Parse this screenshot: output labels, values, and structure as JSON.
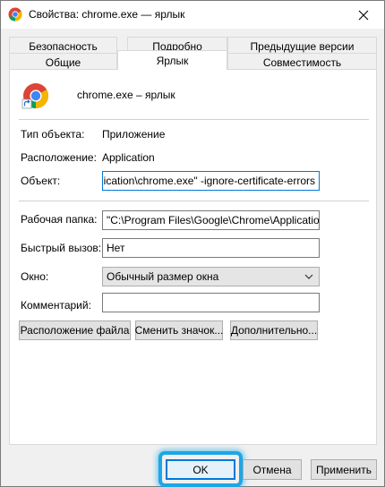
{
  "window": {
    "title": "Свойства: chrome.exe — ярлык"
  },
  "tabs_row1": [
    {
      "label": "Безопасность"
    },
    {
      "label": "Подробно"
    },
    {
      "label": "Предыдущие версии"
    }
  ],
  "tabs_row2": [
    {
      "label": "Общие"
    },
    {
      "label": "Ярлык"
    },
    {
      "label": "Совместимость"
    }
  ],
  "active_tab": "Ярлык",
  "header": {
    "file_name": "chrome.exe – ярлык"
  },
  "info": {
    "type_label": "Тип объекта:",
    "type_value": "Приложение",
    "location_label": "Расположение:",
    "location_value": "Application"
  },
  "fields": {
    "target_label": "Объект:",
    "target_value": "\\Application\\chrome.exe\" -ignore-certificate-errors",
    "start_in_label": "Рабочая папка:",
    "start_in_value": "\"C:\\Program Files\\Google\\Chrome\\Application\"",
    "hotkey_label": "Быстрый вызов:",
    "hotkey_value": "Нет",
    "run_label": "Окно:",
    "run_value": "Обычный размер окна",
    "comment_label": "Комментарий:",
    "comment_value": ""
  },
  "actions": {
    "open_location": "Расположение файла",
    "change_icon": "Сменить значок...",
    "advanced": "Дополнительно..."
  },
  "footer": {
    "ok": "OK",
    "cancel": "Отмена",
    "apply": "Применить"
  },
  "colors": {
    "accent": "#0078d7",
    "highlight": "#1aa7e8"
  }
}
